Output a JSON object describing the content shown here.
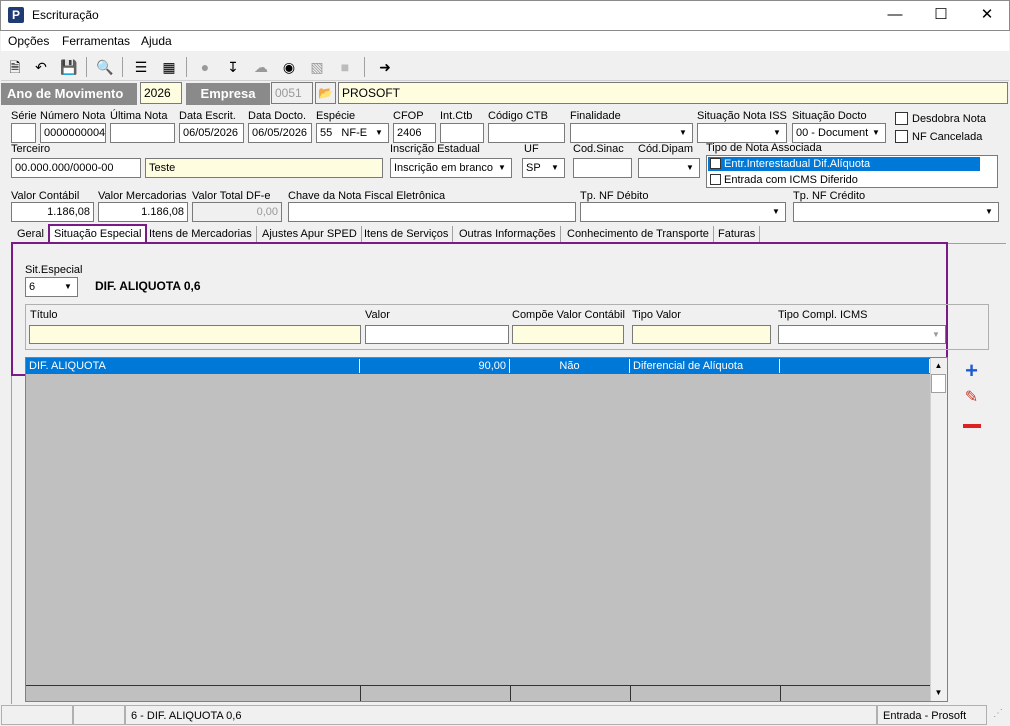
{
  "window": {
    "title": "Escrituração",
    "icon_letter": "P"
  },
  "menu": [
    "Opções",
    "Ferramentas",
    "Ajuda"
  ],
  "header": {
    "ano_label": "Ano de Movimento",
    "ano_value": "2026",
    "empresa_label": "Empresa",
    "empresa_code": "0051",
    "empresa_name": "PROSOFT"
  },
  "fields": {
    "serie_label": "Série",
    "serie": "",
    "numero_label": "Número Nota",
    "numero": "0000000004",
    "ultima_label": "Última Nota",
    "ultima": "",
    "data_escrit_label": "Data Escrit.",
    "data_escrit": "06/05/2026",
    "data_docto_label": "Data Docto.",
    "data_docto": "06/05/2026",
    "especie_label": "Espécie",
    "especie_code": "55",
    "especie": "NF-E",
    "cfop_label": "CFOP",
    "cfop": "2406",
    "intctb_label": "Int.Ctb",
    "intctb": "",
    "codctb_label": "Código CTB",
    "codctb": "",
    "finalidade_label": "Finalidade",
    "finalidade": "",
    "sit_iss_label": "Situação Nota ISS",
    "sit_iss": "",
    "sit_docto_label": "Situação Docto",
    "sit_docto": "00 - Document",
    "desdobra_label": "Desdobra Nota",
    "nfcanc_label": "NF Cancelada",
    "terceiro_label": "Terceiro",
    "terceiro_doc": "00.000.000/0000-00",
    "terceiro_nome": "Teste",
    "ie_label": "Inscrição Estadual",
    "ie": "Inscrição em branco",
    "uf_label": "UF",
    "uf": "SP",
    "sinac_label": "Cod.Sinac",
    "sinac": "",
    "dipam_label": "Cód.Dipam",
    "dipam": "",
    "tipo_assoc_label": "Tipo de Nota Associada",
    "tipo_assoc_items": [
      "Entr.Interestadual Dif.Alíquota",
      "Entrada com ICMS Diferido"
    ],
    "valor_contabil_label": "Valor Contábil",
    "valor_contabil": "1.186,08",
    "valor_merc_label": "Valor Mercadorias",
    "valor_merc": "1.186,08",
    "valor_dfe_label": "Valor Total DF-e",
    "valor_dfe": "0,00",
    "chave_label": "Chave da Nota Fiscal Eletrônica",
    "chave": "",
    "tp_debito_label": "Tp. NF Débito",
    "tp_debito": "",
    "tp_credito_label": "Tp. NF Crédito",
    "tp_credito": ""
  },
  "tabs": [
    "Geral",
    "Situação Especial",
    "Itens de Mercadorias",
    "Ajustes Apur SPED",
    "Itens de Serviços",
    "Outras Informações",
    "Conhecimento de Transporte",
    "Faturas"
  ],
  "sit_especial": {
    "label": "Sit.Especial",
    "value": "6",
    "description": "DIF. ALIQUOTA 0,6"
  },
  "form": {
    "titulo_label": "Título",
    "valor_label": "Valor",
    "compoe_label": "Compõe Valor Contábil",
    "tipo_valor_label": "Tipo Valor",
    "tipo_compl_label": "Tipo Compl. ICMS"
  },
  "grid_row": {
    "titulo": "DIF. ALIQUOTA",
    "valor": "90,00",
    "compoe": "Não",
    "tipo_valor": "Diferencial de Alíquota",
    "tipo_compl": ""
  },
  "status": {
    "middle": "6 - DIF. ALIQUOTA 0,6",
    "right": "Entrada - Prosoft"
  },
  "colors": {
    "accent_highlight": "#7a1a86",
    "selection": "#0078d7",
    "input_yellow": "#fffde0"
  }
}
